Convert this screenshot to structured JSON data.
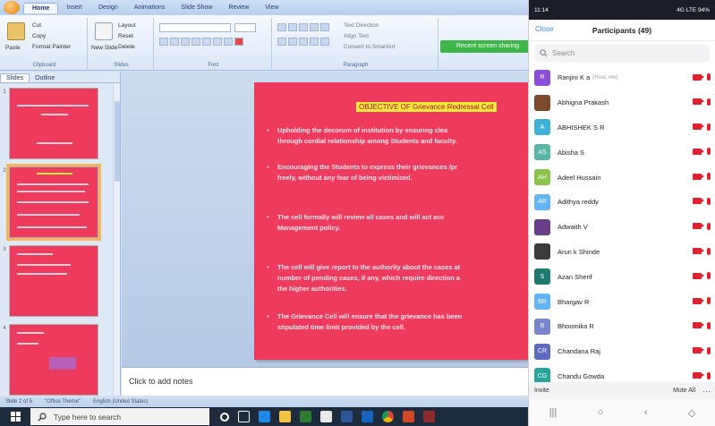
{
  "ppt": {
    "tabs": [
      "Home",
      "Insert",
      "Design",
      "Animations",
      "Slide Show",
      "Review",
      "View"
    ],
    "active_tab": "Home",
    "ribbon": {
      "clipboard": {
        "paste": "Paste",
        "cut": "Cut",
        "copy": "Copy",
        "format_painter": "Format Painter",
        "label": "Clipboard"
      },
      "slides": {
        "new_slide": "New Slide",
        "layout": "Layout",
        "reset": "Reset",
        "delete": "Delete",
        "label": "Slides"
      },
      "font": {
        "label": "Font"
      },
      "paragraph": {
        "label": "Paragraph",
        "text_direction": "Text Direction",
        "align_text": "Align Text",
        "convert": "Convert to SmartArt"
      },
      "banner": "Recent screen sharing"
    },
    "left_panel": {
      "tab_slides": "Slides",
      "tab_outline": "Outline",
      "numbers": [
        "1",
        "2",
        "3",
        "4"
      ]
    },
    "slide": {
      "title": "OBJECTIVE OF Grievance Redressal Cell",
      "bullets": [
        [
          "Upholding the decorum of institution by ensuring clea",
          "through cordial relationship among Students and faculty."
        ],
        [
          "Encouraging the Students to express their grievances /pr",
          "freely, without any fear of being victimized."
        ],
        [
          "The cell formally will review all cases and will act acc",
          "Management policy."
        ],
        [
          "The cell will give report to the authority about the cases at",
          "number of pending cases, if any, which require direction a",
          "the higher authorities."
        ],
        [
          "The Grievance Cell will ensure that the grievance has been ",
          "stipulated time limit provided by the cell."
        ]
      ]
    },
    "notes_placeholder": "Click to add notes",
    "status": {
      "slide_of": "Slide 2 of 5",
      "theme": "\"Office Theme\"",
      "language": "English (United States)"
    }
  },
  "taskbar": {
    "search_placeholder": "Type here to search",
    "search_icon": "search-icon",
    "app_icons": [
      "task-view-icon",
      "file-explorer-icon",
      "store-icon",
      "mail-icon",
      "excel-icon",
      "word-icon",
      "powerpoint-icon",
      "edge-icon",
      "chrome-icon",
      "video-icon"
    ]
  },
  "phone": {
    "status_time": "11:14",
    "status_right": "4G  LTE  94%",
    "close_label": "Close",
    "title": "Participants (49)",
    "search_placeholder": "Search",
    "participants": [
      {
        "initial": "R",
        "name": "Ranjini K a",
        "sub": "(Host, me)",
        "color": "#8a4fd8"
      },
      {
        "initial": "",
        "name": "Abhigna Prakash",
        "sub": "",
        "color": "#7a4a2a"
      },
      {
        "initial": "A",
        "name": "ABHISHEK S R",
        "sub": "",
        "color": "#3fb0d8"
      },
      {
        "initial": "AS",
        "name": "Abisha S",
        "sub": "",
        "color": "#58b6a6"
      },
      {
        "initial": "AH",
        "name": "Adeel Hussain",
        "sub": "",
        "color": "#8bc34a"
      },
      {
        "initial": "AR",
        "name": "Adithya reddy",
        "sub": "",
        "color": "#64b5f6"
      },
      {
        "initial": "",
        "name": "Adwaith V",
        "sub": "",
        "color": "#6a3f8a"
      },
      {
        "initial": "",
        "name": "Arun k Shinde",
        "sub": "",
        "color": "#3b3b3b"
      },
      {
        "initial": "S",
        "name": "Azan Sherif",
        "sub": "",
        "color": "#1f7a6e"
      },
      {
        "initial": "BR",
        "name": "Bhargav R",
        "sub": "",
        "color": "#64b5f6"
      },
      {
        "initial": "B",
        "name": "Bhoomika R",
        "sub": "",
        "color": "#7986cb"
      },
      {
        "initial": "CR",
        "name": "Chandana Raj",
        "sub": "",
        "color": "#5c6bc0"
      },
      {
        "initial": "CG",
        "name": "Chandu Gowda",
        "sub": "",
        "color": "#26a69a"
      }
    ],
    "invite_label": "Invite",
    "mute_all_label": "Mute All",
    "more_label": "···"
  }
}
